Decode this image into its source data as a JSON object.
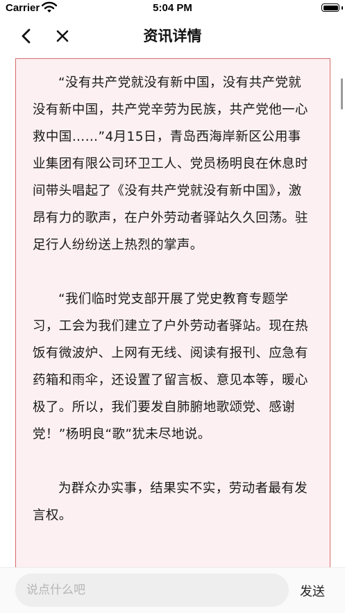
{
  "status_bar": {
    "carrier": "Carrier",
    "time": "5:04 PM",
    "battery_level": 1.0,
    "icons": [
      "wifi-icon",
      "battery-icon"
    ]
  },
  "nav": {
    "title": "资讯详情",
    "back_icon": "chevron-left-icon",
    "close_icon": "close-icon"
  },
  "article": {
    "background_color": "#fcf0f2",
    "border_color": "#d96a6a",
    "paragraphs": [
      "“没有共产党就没有新中国，没有共产党就没有新中国，共产党辛劳为民族，共产党他一心救中国……”4月15日，青岛西海岸新区公用事业集团有限公司环卫工人、党员杨明良在休息时间带头唱起了《没有共产党就没有新中国》，激昂有力的歌声，在户外劳动者驿站久久回荡。驻足行人纷纷送上热烈的掌声。",
      "“我们临时党支部开展了党史教育专题学习，工会为我们建立了户外劳动者驿站。现在热饭有微波炉、上网有无线、阅读有报刊、应急有药箱和雨伞，还设置了留言板、意见本等，暖心极了。所以，我们要发自肺腑地歌颂党、感谢党！”杨明良“歌”犹未尽地说。",
      "为群众办实事，结果实不实，劳动者最有发言权。"
    ]
  },
  "comment": {
    "placeholder": "说点什么吧",
    "value": "",
    "send_label": "发送"
  }
}
